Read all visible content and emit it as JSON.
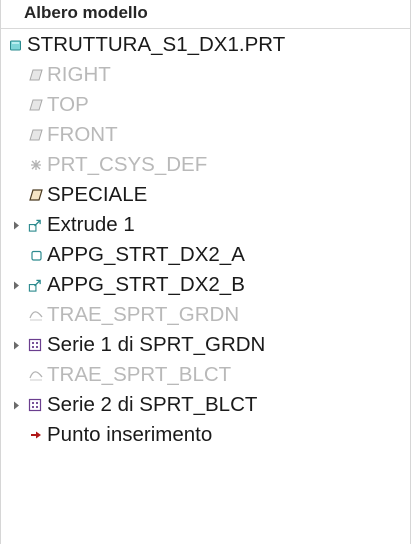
{
  "panel": {
    "title": "Albero modello",
    "root": {
      "label": "STRUTTURA_S1_DX1.PRT",
      "icon": "part-icon"
    },
    "items": [
      {
        "label": "RIGHT",
        "icon": "datum-plane-icon",
        "disabled": true,
        "expandable": false
      },
      {
        "label": "TOP",
        "icon": "datum-plane-icon",
        "disabled": true,
        "expandable": false
      },
      {
        "label": "FRONT",
        "icon": "datum-plane-icon",
        "disabled": true,
        "expandable": false
      },
      {
        "label": "PRT_CSYS_DEF",
        "icon": "coordinate-system-icon",
        "disabled": true,
        "expandable": false
      },
      {
        "label": "SPECIALE",
        "icon": "datum-plane-icon",
        "disabled": false,
        "expandable": false
      },
      {
        "label": "Extrude 1",
        "icon": "extrude-icon",
        "disabled": false,
        "expandable": true
      },
      {
        "label": "APPG_STRT_DX2_A",
        "icon": "solid-feature-icon",
        "disabled": false,
        "expandable": false
      },
      {
        "label": "APPG_STRT_DX2_B",
        "icon": "extrude-icon",
        "disabled": false,
        "expandable": true
      },
      {
        "label": "TRAE_SPRT_GRDN",
        "icon": "curve-icon",
        "disabled": true,
        "expandable": false
      },
      {
        "label": "Serie 1 di SPRT_GRDN",
        "icon": "pattern-icon",
        "disabled": false,
        "expandable": true
      },
      {
        "label": "TRAE_SPRT_BLCT",
        "icon": "curve-icon",
        "disabled": true,
        "expandable": false
      },
      {
        "label": "Serie 2 di SPRT_BLCT",
        "icon": "pattern-icon",
        "disabled": false,
        "expandable": true
      },
      {
        "label": "Punto inserimento",
        "icon": "insert-arrow-icon",
        "disabled": false,
        "expandable": false
      }
    ]
  }
}
